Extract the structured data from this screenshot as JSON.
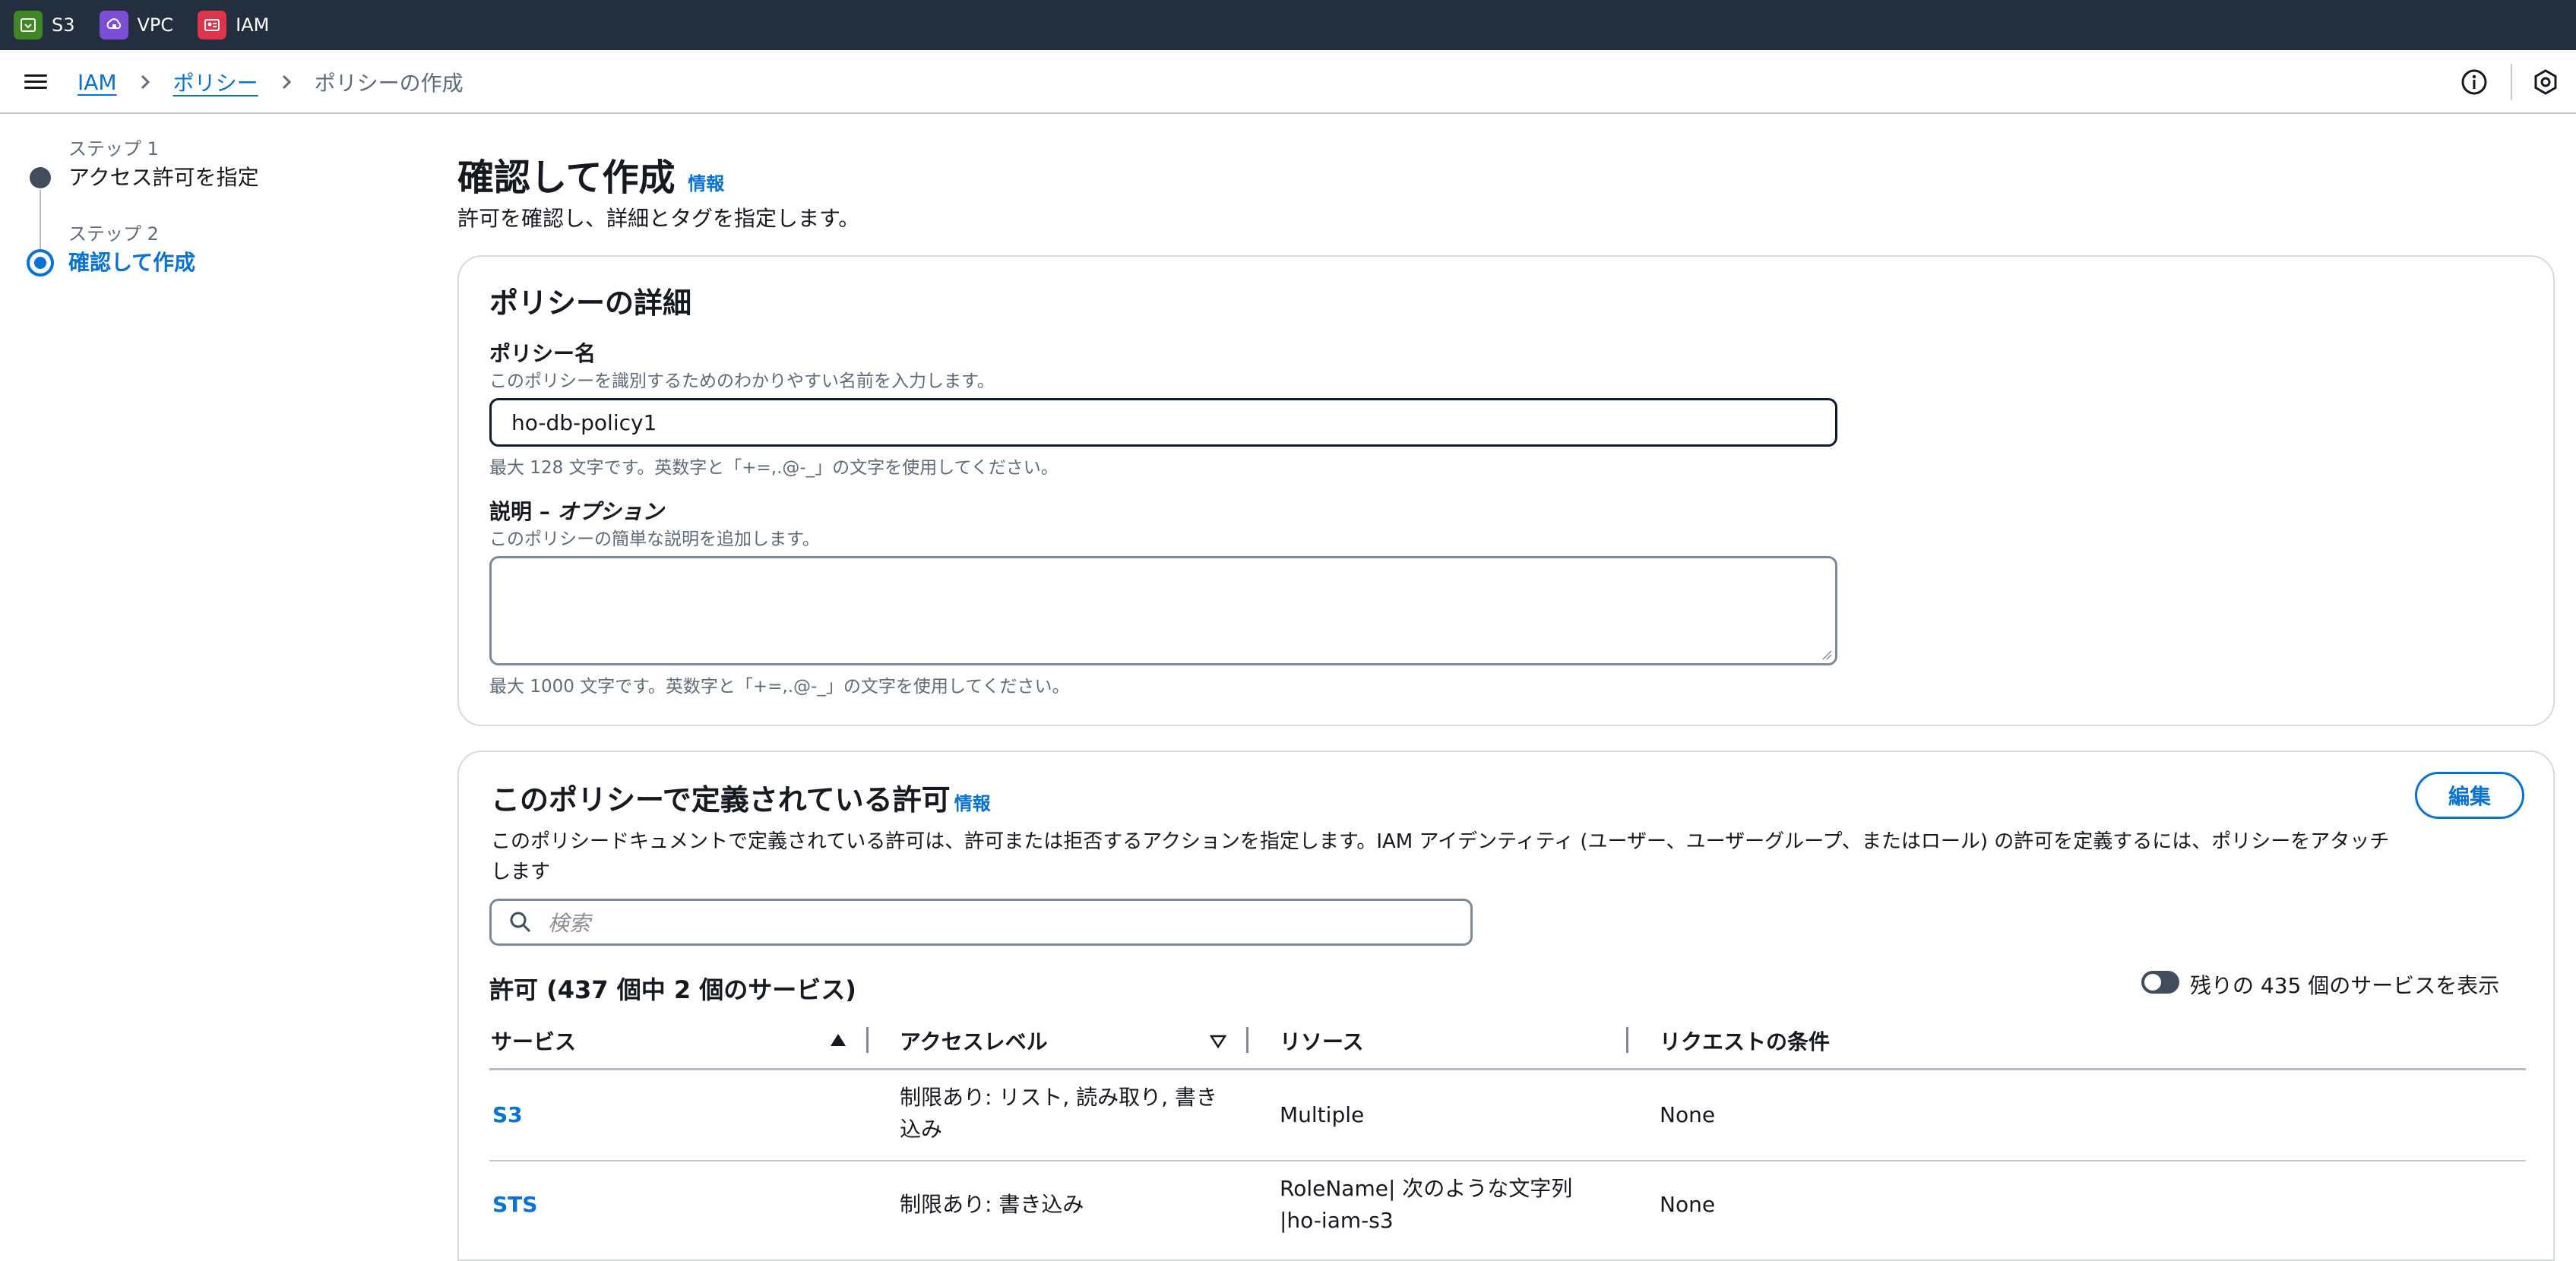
{
  "topbar": {
    "services": [
      {
        "label": "S3",
        "icon": "s3-service-icon",
        "color": "#3f8624"
      },
      {
        "label": "VPC",
        "icon": "vpc-service-icon",
        "color": "#7c4dd6"
      },
      {
        "label": "IAM",
        "icon": "iam-service-icon",
        "color": "#dd344c"
      }
    ]
  },
  "breadcrumb": {
    "items": [
      "IAM",
      "ポリシー"
    ],
    "current": "ポリシーの作成"
  },
  "steps": [
    {
      "number": "ステップ 1",
      "title": "アクセス許可を指定",
      "state": "completed"
    },
    {
      "number": "ステップ 2",
      "title": "確認して作成",
      "state": "current"
    }
  ],
  "page": {
    "title": "確認して作成",
    "info": "情報",
    "description": "許可を確認し、詳細とタグを指定します。"
  },
  "details": {
    "heading": "ポリシーの詳細",
    "name_label": "ポリシー名",
    "name_desc": "このポリシーを識別するためのわかりやすい名前を入力します。",
    "name_value": "ho-db-policy1",
    "name_hint": "最大 128 文字です。英数字と「+=,.@-_」の文字を使用してください。",
    "desc_label": "説明 – ",
    "desc_optional": "オプション",
    "desc_desc": "このポリシーの簡単な説明を追加します。",
    "desc_value": "",
    "desc_hint": "最大 1000 文字です。英数字と「+=,.@-_」の文字を使用してください。"
  },
  "permissions": {
    "heading": "このポリシーで定義されている許可",
    "info": "情報",
    "edit_label": "編集",
    "description_line1": "このポリシードキュメントで定義されている許可は、許可または拒否するアクションを指定します。IAM アイデンティティ (ユーザー、ユーザーグループ、またはロール) の許可を定義するには、ポリシーをアタッチ",
    "description_line2": "します",
    "search_placeholder": "検索",
    "count_title": "許可 (437 個中 2 個のサービス)",
    "toggle_label": "残りの 435 個のサービスを表示",
    "toggle_on": false,
    "columns": [
      "サービス",
      "アクセスレベル",
      "リソース",
      "リクエストの条件"
    ],
    "sort": {
      "サービス": "ascending",
      "アクセスレベル": "sortable"
    },
    "rows": [
      {
        "service": "S3",
        "access_line1": "制限あり: リスト, 読み取り, 書き",
        "access_line2": "込み",
        "resource_line1": "Multiple",
        "resource_line2": "",
        "condition": "None"
      },
      {
        "service": "STS",
        "access_line1": "制限あり: 書き込み",
        "access_line2": "",
        "resource_line1": "RoleName| 次のような文字列",
        "resource_line2": "|ho-iam-s3",
        "condition": "None"
      }
    ]
  }
}
